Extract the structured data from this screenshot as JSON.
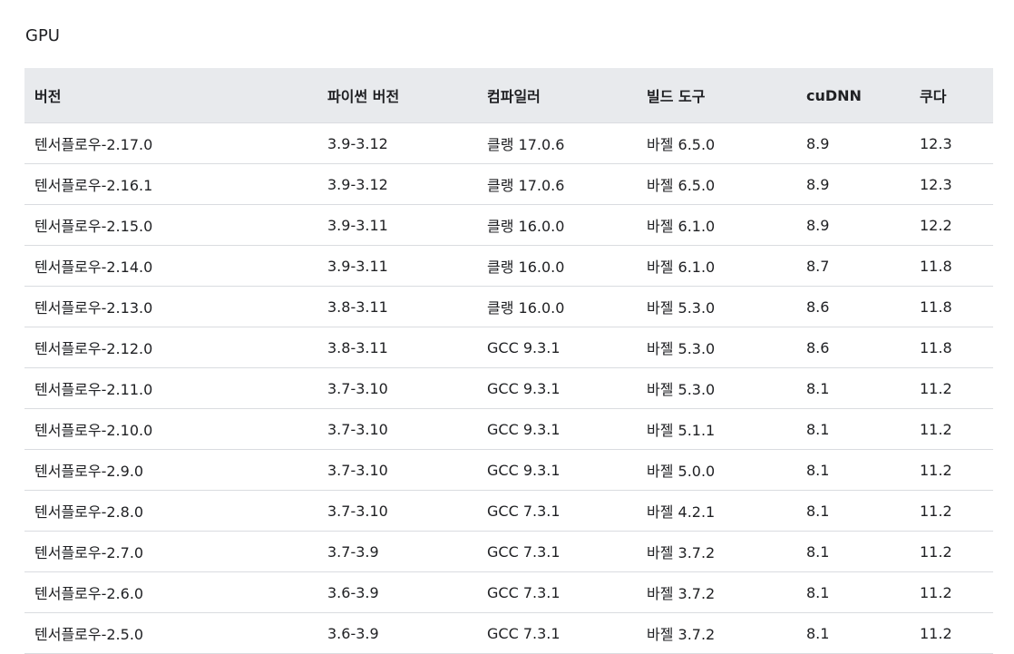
{
  "section_title": "GPU",
  "table": {
    "headers": [
      "버전",
      "파이썬 버전",
      "컴파일러",
      "빌드 도구",
      "cuDNN",
      "쿠다"
    ],
    "rows": [
      [
        "텐서플로우-2.17.0",
        "3.9-3.12",
        "클랭 17.0.6",
        "바젤 6.5.0",
        "8.9",
        "12.3"
      ],
      [
        "텐서플로우-2.16.1",
        "3.9-3.12",
        "클랭 17.0.6",
        "바젤 6.5.0",
        "8.9",
        "12.3"
      ],
      [
        "텐서플로우-2.15.0",
        "3.9-3.11",
        "클랭 16.0.0",
        "바젤 6.1.0",
        "8.9",
        "12.2"
      ],
      [
        "텐서플로우-2.14.0",
        "3.9-3.11",
        "클랭 16.0.0",
        "바젤 6.1.0",
        "8.7",
        "11.8"
      ],
      [
        "텐서플로우-2.13.0",
        "3.8-3.11",
        "클랭 16.0.0",
        "바젤 5.3.0",
        "8.6",
        "11.8"
      ],
      [
        "텐서플로우-2.12.0",
        "3.8-3.11",
        "GCC 9.3.1",
        "바젤 5.3.0",
        "8.6",
        "11.8"
      ],
      [
        "텐서플로우-2.11.0",
        "3.7-3.10",
        "GCC 9.3.1",
        "바젤 5.3.0",
        "8.1",
        "11.2"
      ],
      [
        "텐서플로우-2.10.0",
        "3.7-3.10",
        "GCC 9.3.1",
        "바젤 5.1.1",
        "8.1",
        "11.2"
      ],
      [
        "텐서플로우-2.9.0",
        "3.7-3.10",
        "GCC 9.3.1",
        "바젤 5.0.0",
        "8.1",
        "11.2"
      ],
      [
        "텐서플로우-2.8.0",
        "3.7-3.10",
        "GCC 7.3.1",
        "바젤 4.2.1",
        "8.1",
        "11.2"
      ],
      [
        "텐서플로우-2.7.0",
        "3.7-3.9",
        "GCC 7.3.1",
        "바젤 3.7.2",
        "8.1",
        "11.2"
      ],
      [
        "텐서플로우-2.6.0",
        "3.6-3.9",
        "GCC 7.3.1",
        "바젤 3.7.2",
        "8.1",
        "11.2"
      ],
      [
        "텐서플로우-2.5.0",
        "3.6-3.9",
        "GCC 7.3.1",
        "바젤 3.7.2",
        "8.1",
        "11.2"
      ]
    ]
  }
}
